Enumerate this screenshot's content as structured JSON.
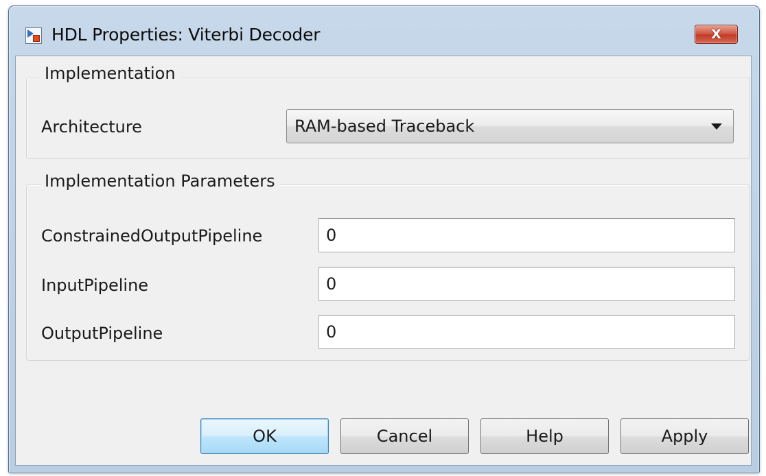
{
  "window": {
    "title": "HDL Properties: Viterbi Decoder",
    "app_icon": "simulink-block-icon",
    "close_icon": "close-x-icon",
    "close_label": "X"
  },
  "implementation": {
    "group_title": "Implementation",
    "architecture_label": "Architecture",
    "architecture_value": "RAM-based Traceback",
    "dropdown_icon": "chevron-down-icon"
  },
  "parameters": {
    "group_title": "Implementation Parameters",
    "fields": [
      {
        "label": "ConstrainedOutputPipeline",
        "value": "0"
      },
      {
        "label": "InputPipeline",
        "value": "0"
      },
      {
        "label": "OutputPipeline",
        "value": "0"
      }
    ]
  },
  "buttons": {
    "ok": "OK",
    "cancel": "Cancel",
    "help": "Help",
    "apply": "Apply"
  },
  "colors": {
    "frame": "#bdd0e5",
    "close_button": "#c23c28",
    "default_button": "#bee6fd",
    "client_background": "#f0f0f0"
  }
}
